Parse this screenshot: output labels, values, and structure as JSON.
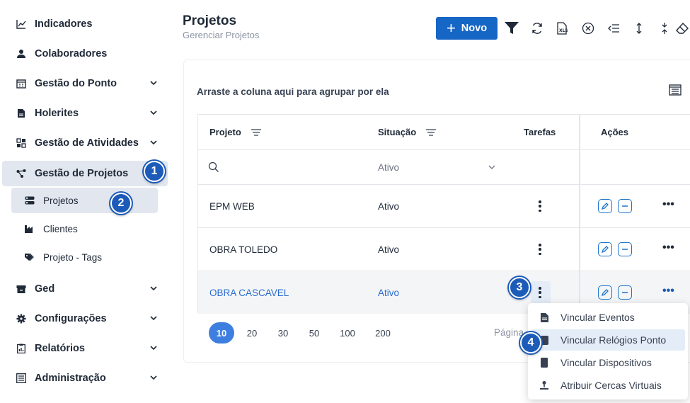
{
  "sidebar": {
    "items": [
      {
        "label": "Indicadores",
        "icon": "chart-line-icon"
      },
      {
        "label": "Colaboradores",
        "icon": "user-icon"
      },
      {
        "label": "Gestão do Ponto",
        "icon": "calendar-icon"
      },
      {
        "label": "Holerites",
        "icon": "document-icon"
      },
      {
        "label": "Gestão de Atividades",
        "icon": "grid-icon"
      },
      {
        "label": "Gestão de Projetos",
        "icon": "project-tree-icon"
      },
      {
        "label": "Ged",
        "icon": "archive-box-icon"
      },
      {
        "label": "Configurações",
        "icon": "gear-icon"
      },
      {
        "label": "Relatórios",
        "icon": "report-icon"
      },
      {
        "label": "Administração",
        "icon": "admin-list-icon"
      }
    ],
    "subitems": [
      {
        "label": "Projetos",
        "icon": "toggle-list-icon"
      },
      {
        "label": "Clientes",
        "icon": "factory-icon"
      },
      {
        "label": "Projeto - Tags",
        "icon": "tag-icon"
      }
    ]
  },
  "badges": {
    "b1": "1",
    "b2": "2",
    "b3": "3",
    "b4": "4"
  },
  "header": {
    "title": "Projetos",
    "subtitle": "Gerenciar Projetos",
    "new_label": "Novo"
  },
  "grid": {
    "group_hint": "Arraste a coluna aqui para agrupar por ela",
    "columns": {
      "projeto": "Projeto",
      "situacao": "Situação",
      "tarefas": "Tarefas",
      "acoes": "Ações"
    },
    "filter": {
      "situacao": "Ativo"
    },
    "rows": [
      {
        "projeto": "EPM WEB",
        "situacao": "Ativo"
      },
      {
        "projeto": "OBRA TOLEDO",
        "situacao": "Ativo"
      },
      {
        "projeto": "OBRA CASCAVEL",
        "situacao": "Ativo"
      }
    ]
  },
  "pager": {
    "sizes": [
      "10",
      "20",
      "30",
      "50",
      "100",
      "200"
    ],
    "selected": "10",
    "page_label": "Página"
  },
  "context_menu": {
    "items": [
      {
        "label": "Vincular Eventos",
        "icon": "file-icon"
      },
      {
        "label": "Vincular Relógios Ponto",
        "icon": "clock-device-icon"
      },
      {
        "label": "Vincular Dispositivos",
        "icon": "mobile-device-icon"
      },
      {
        "label": "Atribuir Cercas Virtuais",
        "icon": "location-pin-icon"
      }
    ]
  },
  "colors": {
    "accent": "#1666c5",
    "badge": "#1c5bb8",
    "link": "#2a6dd0",
    "active_bg": "#e2e6ee"
  }
}
